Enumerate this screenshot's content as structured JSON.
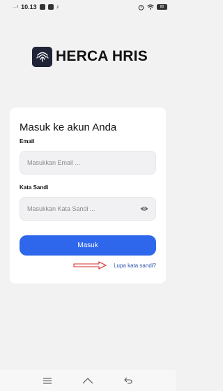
{
  "status_bar": {
    "signal": "....ıl",
    "time": "10.13",
    "battery": "80",
    "icons": [
      "mail-icon",
      "gallery-icon",
      "tiktok-icon",
      "alarm-icon",
      "wifi-icon",
      "battery-icon"
    ]
  },
  "brand": {
    "name": "HERCA HRIS",
    "logo_icon": "fingerprint-icon"
  },
  "login": {
    "title": "Masuk ke akun Anda",
    "email_label": "Email",
    "email_placeholder": "Masukkan Email ...",
    "email_value": "",
    "password_label": "Kata Sandi",
    "password_placeholder": "Masukkan Kata Sandi ...",
    "password_value": "",
    "submit_label": "Masuk",
    "forgot_label": "Lupa kata sandi?"
  },
  "colors": {
    "accent": "#2f67ec",
    "link": "#2f56b0",
    "annotation": "#d42a2a",
    "background": "#f2f2f3"
  },
  "nav_bar": {
    "icons": [
      "menu-icon",
      "home-icon",
      "back-icon"
    ]
  }
}
